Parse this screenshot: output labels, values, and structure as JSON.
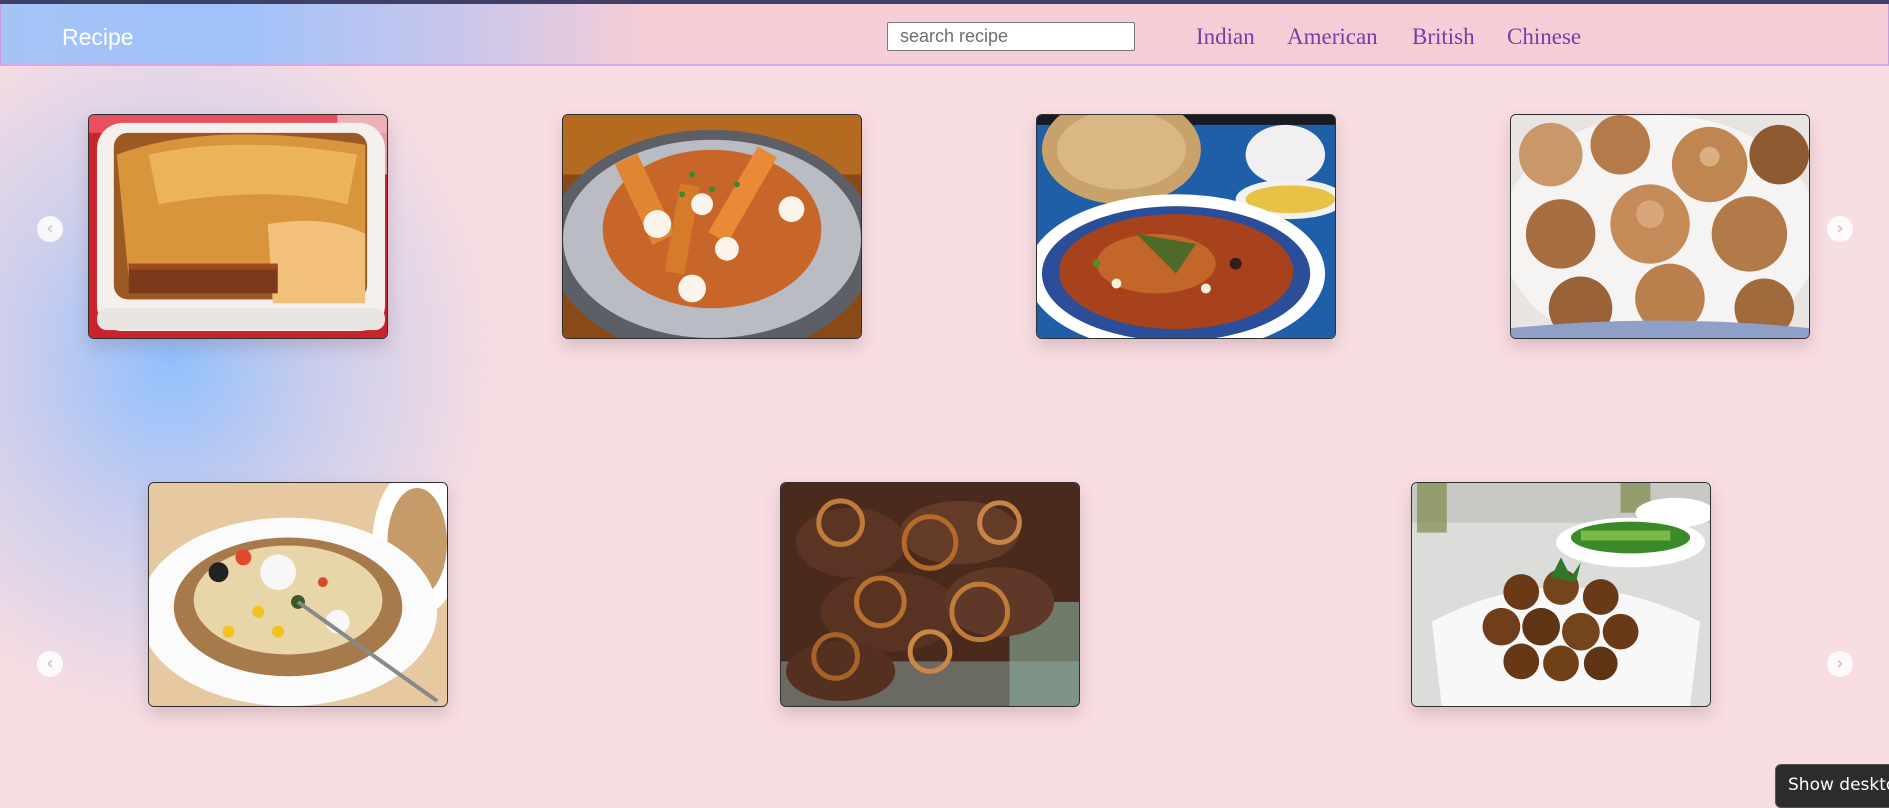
{
  "app": {
    "brand": "Recipe"
  },
  "search": {
    "placeholder": "search recipe",
    "value": ""
  },
  "nav": {
    "links": [
      "Indian",
      "American",
      "British",
      "Chinese"
    ]
  },
  "carousels": [
    {
      "items": [
        "lasagna-photo",
        "poutine-photo",
        "vegetable-stew-photo",
        "sugar-donuts-photo"
      ]
    },
    {
      "items": [
        "stuffed-baked-potato-photo",
        "beef-and-onions-photo",
        "falafel-photo"
      ]
    }
  ],
  "icons": {
    "prev": "chevron-left-icon",
    "next": "chevron-right-icon"
  },
  "tooltip": {
    "text": "Show desktop"
  },
  "colors": {
    "nav_link": "#7b3aa6",
    "page_background": "#f8dde2",
    "accent_blue": "#9fc2fb"
  }
}
